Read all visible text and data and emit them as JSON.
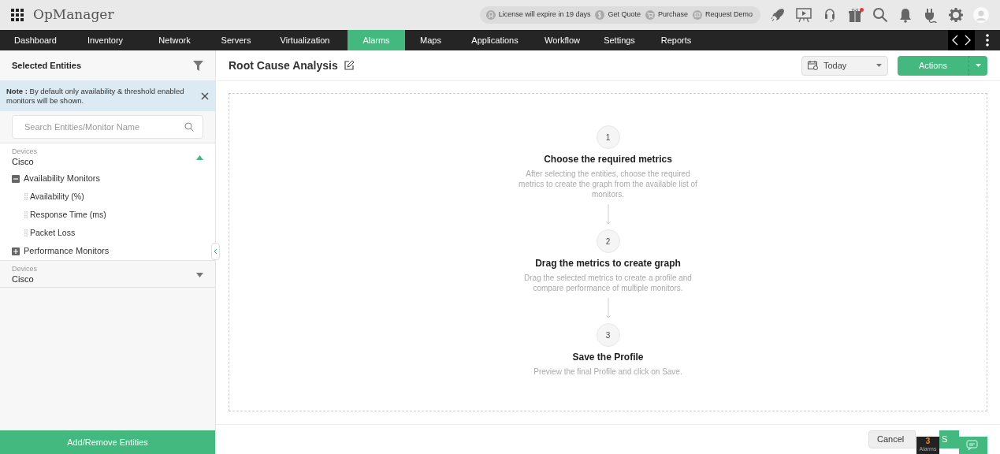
{
  "app": {
    "name": "OpManager"
  },
  "license_bar": [
    {
      "kind": "license",
      "label": "License will expire in 19 days"
    },
    {
      "kind": "quote",
      "label": "Get Quote"
    },
    {
      "kind": "purchase",
      "label": "Purchase"
    },
    {
      "kind": "demo",
      "label": "Request Demo"
    }
  ],
  "toolbar": [
    {
      "kind": "rocket"
    },
    {
      "kind": "presentation"
    },
    {
      "kind": "headset"
    },
    {
      "kind": "gift",
      "badge": true
    },
    {
      "kind": "search"
    },
    {
      "kind": "bell"
    },
    {
      "kind": "plug"
    },
    {
      "kind": "gear"
    },
    {
      "kind": "avatar"
    }
  ],
  "nav": [
    {
      "label": "Dashboard",
      "selected": false
    },
    {
      "label": "Inventory",
      "selected": false
    },
    {
      "label": "Network",
      "selected": false
    },
    {
      "label": "Servers",
      "selected": false
    },
    {
      "label": "Virtualization",
      "selected": false
    },
    {
      "label": "Alarms",
      "selected": true
    },
    {
      "label": "Maps",
      "selected": false
    },
    {
      "label": "Applications",
      "selected": false
    },
    {
      "label": "Workflow",
      "selected": false
    },
    {
      "label": "Settings",
      "selected": false
    },
    {
      "label": "Reports",
      "selected": false
    }
  ],
  "sidebar": {
    "title": "Selected Entities",
    "note": "**Note :** By default only availability & threshold enabled monitors will be shown.",
    "search": {
      "placeholder": "Search Entities/Monitor Name"
    },
    "groups": [
      {
        "label": "Devices",
        "name": "Cisco",
        "expanded": true,
        "children": [
          {
            "label": "Availability Monitors",
            "expanded": true,
            "children": [
              {
                "label": "Availability (%)"
              },
              {
                "label": "Response Time (ms)"
              },
              {
                "label": "Packet Loss"
              }
            ]
          },
          {
            "label": "Performance Monitors",
            "expanded": false
          }
        ]
      },
      {
        "label": "Devices",
        "name": "Cisco",
        "expanded": false
      }
    ],
    "footer_button": "Add/Remove Entities"
  },
  "main": {
    "title": "Root Cause Analysis",
    "date_filter": "Today",
    "actions": "Actions",
    "steps": [
      {
        "number": "1",
        "title": "Choose the required metrics",
        "text": "After selecting the entities, choose the required metrics to create the graph from the available list of monitors."
      },
      {
        "number": "2",
        "title": "Drag the metrics to create graph",
        "text": "Drag the selected metrics to create a profile and compare performance of multiple monitors."
      },
      {
        "number": "3",
        "title": "Save the Profile",
        "text": "Preview the final Profile and click on Save."
      }
    ],
    "buttons": {
      "cancel": "Cancel",
      "save": "S"
    }
  },
  "alarm_badge": {
    "count": "3",
    "label": "Alarms"
  }
}
